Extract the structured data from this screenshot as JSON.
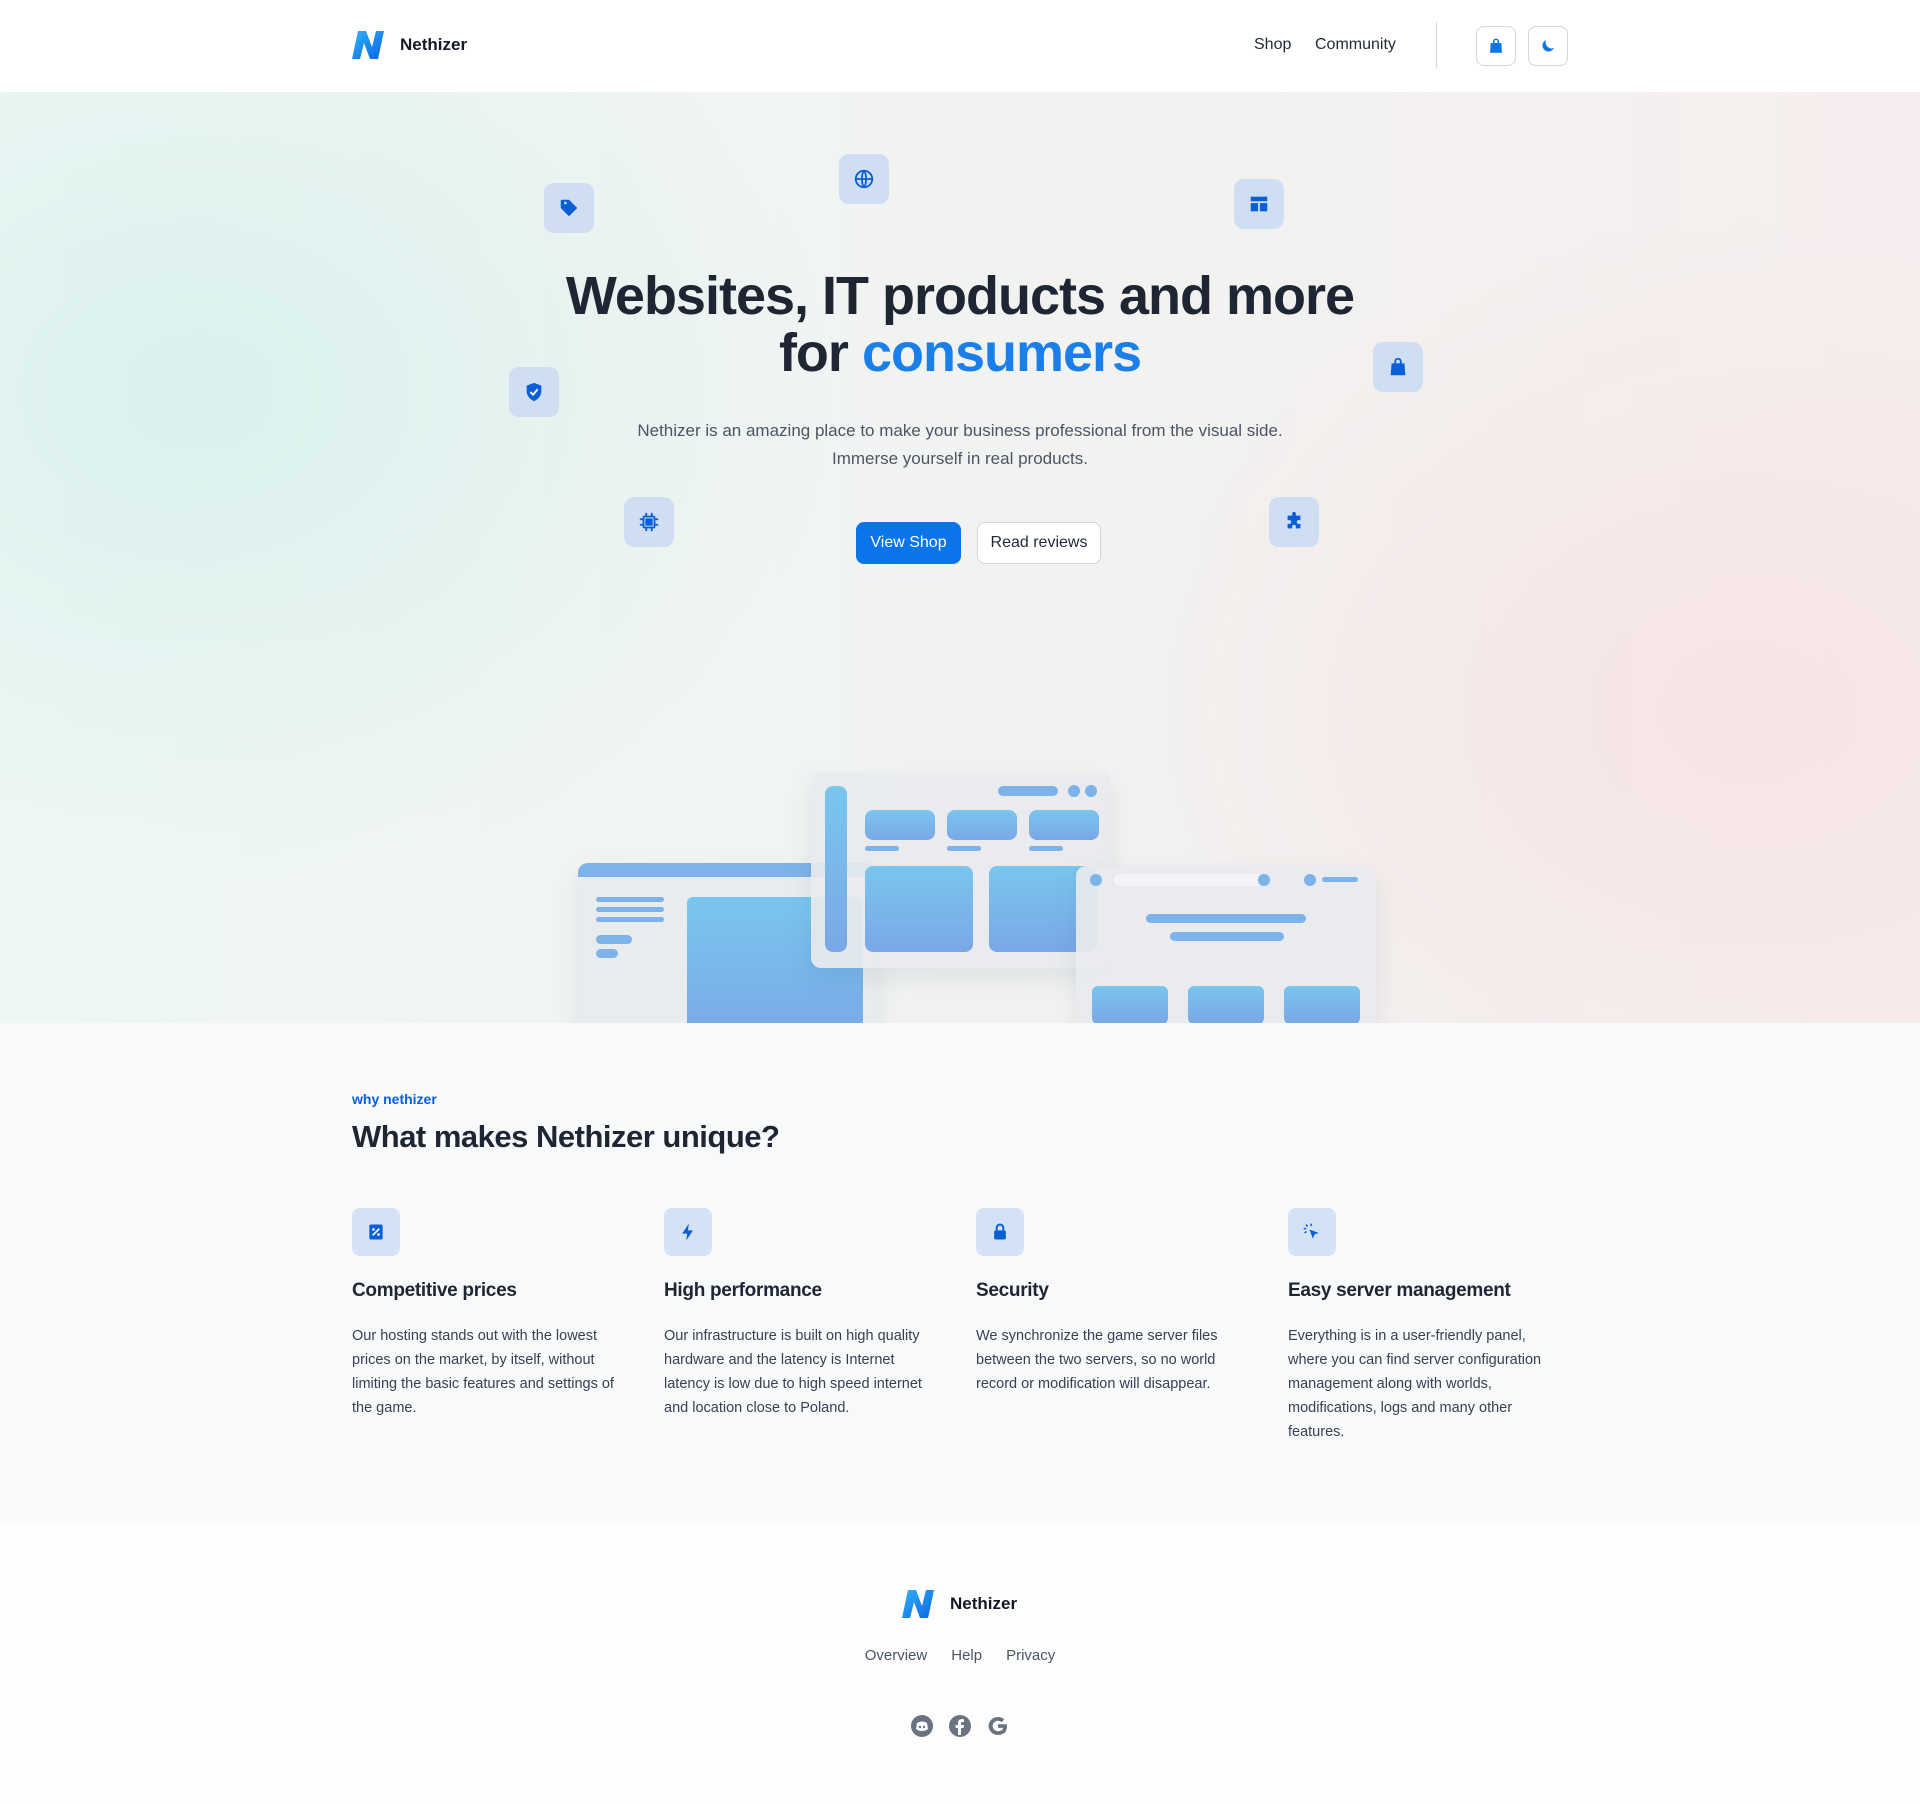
{
  "brand": {
    "name": "Nethizer",
    "accent": "#0b74e8"
  },
  "nav": {
    "shop": "Shop",
    "community": "Community",
    "cart_icon": "shopping-bag-icon",
    "theme_icon": "moon-icon"
  },
  "hero": {
    "title_line1": "Websites, IT products and more",
    "title_line2_prefix": "for ",
    "title_line2_accent": "consumers",
    "subtitle_line1": "Nethizer is an amazing place to make your business professional from the visual side.",
    "subtitle_line2": "Immerse yourself in real products.",
    "primary_cta": "View Shop",
    "secondary_cta": "Read reviews",
    "floating_icons": [
      "tag-icon",
      "globe-icon",
      "layout-icon",
      "shield-check-icon",
      "shopping-bag-icon",
      "cpu-icon",
      "puzzle-icon"
    ]
  },
  "features": {
    "eyebrow": "why nethizer",
    "title": "What makes Nethizer unique?",
    "items": [
      {
        "icon": "percent-receipt-icon",
        "title": "Competitive prices",
        "text": "Our hosting stands out with the lowest prices on the market, by itself, without limiting the basic features and settings of the game."
      },
      {
        "icon": "lightning-icon",
        "title": "High performance",
        "text": "Our infrastructure is built on high quality hardware and the latency is Internet latency is low due to high speed internet and location close to Poland."
      },
      {
        "icon": "lock-icon",
        "title": "Security",
        "text": "We synchronize the game server files between the two servers, so no world record or modification will disappear."
      },
      {
        "icon": "cursor-click-icon",
        "title": "Easy server management",
        "text": "Everything is in a user-friendly panel, where you can find server configuration management along with worlds, modifications, logs and many other features."
      }
    ]
  },
  "footer": {
    "brand": "Nethizer",
    "links": [
      "Overview",
      "Help",
      "Privacy"
    ],
    "social": [
      "discord-icon",
      "facebook-icon",
      "google-icon"
    ]
  }
}
